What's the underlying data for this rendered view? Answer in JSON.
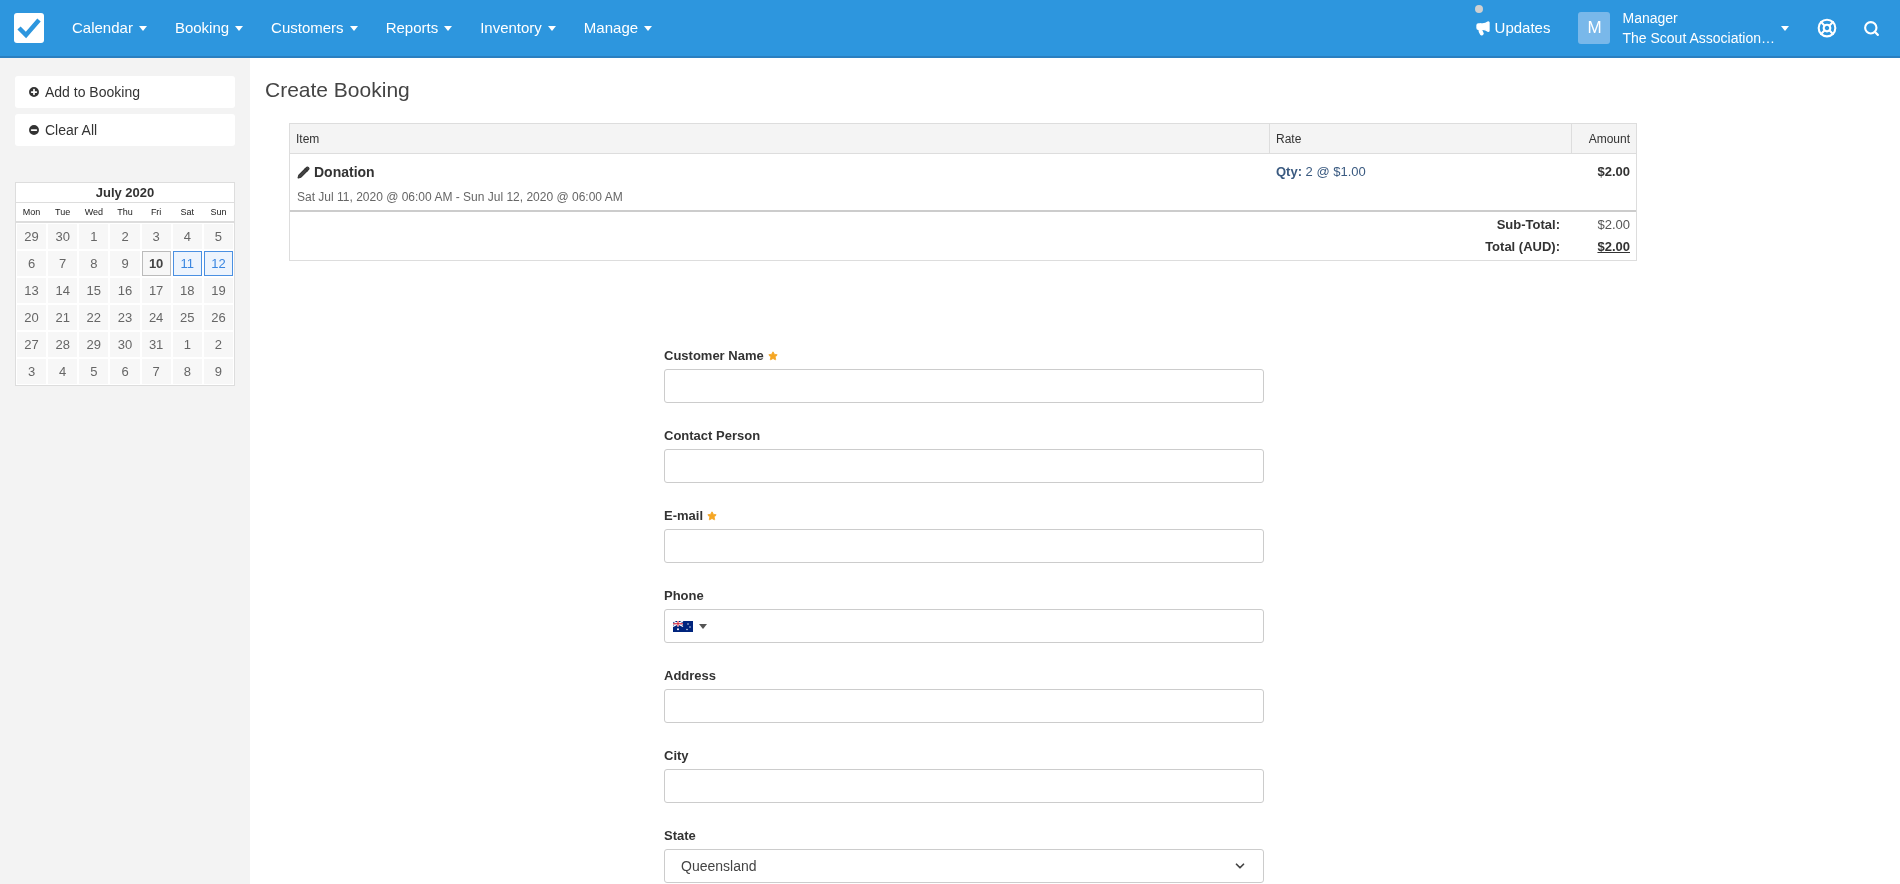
{
  "nav": {
    "menus": [
      {
        "label": "Calendar"
      },
      {
        "label": "Booking"
      },
      {
        "label": "Customers"
      },
      {
        "label": "Reports"
      },
      {
        "label": "Inventory"
      },
      {
        "label": "Manage"
      }
    ],
    "updates": {
      "label": "Updates"
    },
    "user": {
      "initial": "M",
      "role": "Manager",
      "organisation": "The Scout Association…"
    }
  },
  "sidebar": {
    "buttons": [
      {
        "label": "Add to Booking",
        "kind": "add"
      },
      {
        "label": "Clear All",
        "kind": "remove"
      }
    ],
    "calendar": {
      "title": "July 2020",
      "weekdays": [
        "Mon",
        "Tue",
        "Wed",
        "Thu",
        "Fri",
        "Sat",
        "Sun"
      ],
      "weeks": [
        [
          {
            "label": "29",
            "selected": false,
            "today": false
          },
          {
            "label": "30",
            "selected": false,
            "today": false
          },
          {
            "label": "1",
            "selected": false,
            "today": false
          },
          {
            "label": "2",
            "selected": false,
            "today": false
          },
          {
            "label": "3",
            "selected": false,
            "today": false
          },
          {
            "label": "4",
            "selected": false,
            "today": false
          },
          {
            "label": "5",
            "selected": false,
            "today": false
          }
        ],
        [
          {
            "label": "6",
            "selected": false,
            "today": false
          },
          {
            "label": "7",
            "selected": false,
            "today": false
          },
          {
            "label": "8",
            "selected": false,
            "today": false
          },
          {
            "label": "9",
            "selected": false,
            "today": false
          },
          {
            "label": "10",
            "selected": false,
            "today": true
          },
          {
            "label": "11",
            "selected": true,
            "today": false
          },
          {
            "label": "12",
            "selected": true,
            "today": false
          }
        ],
        [
          {
            "label": "13",
            "selected": false,
            "today": false
          },
          {
            "label": "14",
            "selected": false,
            "today": false
          },
          {
            "label": "15",
            "selected": false,
            "today": false
          },
          {
            "label": "16",
            "selected": false,
            "today": false
          },
          {
            "label": "17",
            "selected": false,
            "today": false
          },
          {
            "label": "18",
            "selected": false,
            "today": false
          },
          {
            "label": "19",
            "selected": false,
            "today": false
          }
        ],
        [
          {
            "label": "20",
            "selected": false,
            "today": false
          },
          {
            "label": "21",
            "selected": false,
            "today": false
          },
          {
            "label": "22",
            "selected": false,
            "today": false
          },
          {
            "label": "23",
            "selected": false,
            "today": false
          },
          {
            "label": "24",
            "selected": false,
            "today": false
          },
          {
            "label": "25",
            "selected": false,
            "today": false
          },
          {
            "label": "26",
            "selected": false,
            "today": false
          }
        ],
        [
          {
            "label": "27",
            "selected": false,
            "today": false
          },
          {
            "label": "28",
            "selected": false,
            "today": false
          },
          {
            "label": "29",
            "selected": false,
            "today": false
          },
          {
            "label": "30",
            "selected": false,
            "today": false
          },
          {
            "label": "31",
            "selected": false,
            "today": false
          },
          {
            "label": "1",
            "selected": false,
            "today": false
          },
          {
            "label": "2",
            "selected": false,
            "today": false
          }
        ],
        [
          {
            "label": "3",
            "selected": false,
            "today": false
          },
          {
            "label": "4",
            "selected": false,
            "today": false
          },
          {
            "label": "5",
            "selected": false,
            "today": false
          },
          {
            "label": "6",
            "selected": false,
            "today": false
          },
          {
            "label": "7",
            "selected": false,
            "today": false
          },
          {
            "label": "8",
            "selected": false,
            "today": false
          },
          {
            "label": "9",
            "selected": false,
            "today": false
          }
        ]
      ]
    }
  },
  "page": {
    "title": "Create Booking"
  },
  "table": {
    "columns": [
      "Item",
      "Rate",
      "Amount"
    ],
    "rows": [
      {
        "item": "Donation",
        "dates": "Sat Jul 11, 2020 @ 06:00 AM - Sun Jul 12, 2020 @ 06:00 AM",
        "rate": "**Qty:** 2 @ $1.00",
        "amount": "$2.00"
      }
    ],
    "totals": [
      {
        "label": "Sub-Total:",
        "value": "$2.00",
        "kind": "subtotal"
      },
      {
        "label": "Total (AUD):",
        "value": "$2.00",
        "kind": "total"
      }
    ]
  },
  "form": {
    "fields": [
      {
        "label": "Customer Name",
        "required": true,
        "kind": "text"
      },
      {
        "label": "Contact Person",
        "required": false,
        "kind": "text"
      },
      {
        "label": "E-mail",
        "required": true,
        "kind": "text"
      },
      {
        "label": "Phone",
        "required": false,
        "kind": "phone"
      },
      {
        "label": "Address",
        "required": false,
        "kind": "text"
      },
      {
        "label": "City",
        "required": false,
        "kind": "text"
      },
      {
        "label": "State",
        "required": false,
        "kind": "select",
        "value": "Queensland"
      }
    ]
  }
}
